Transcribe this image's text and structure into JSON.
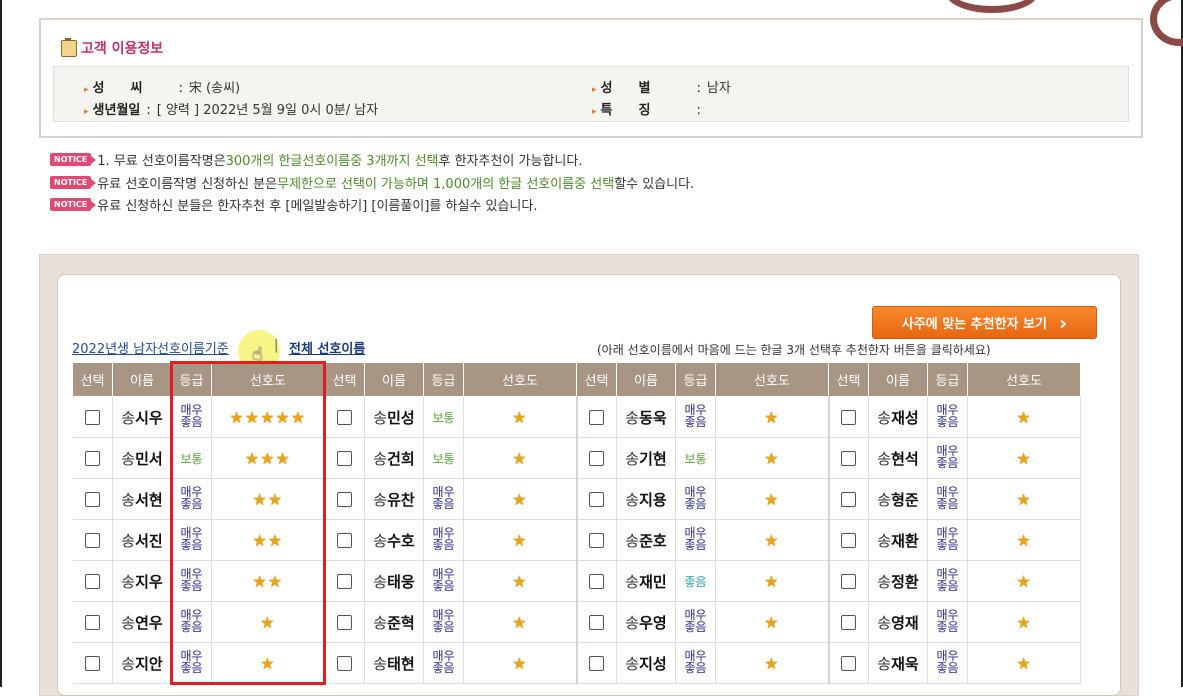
{
  "customer": {
    "title": "고객 이용정보",
    "surname_label": "성　　씨",
    "surname_value": "宋 (송씨)",
    "birth_label": "생년월일",
    "birth_value": "[ 양력 ] 2022년 5월 9일 0시 0분/ 남자",
    "gender_label": "성　　별",
    "gender_value": "남자",
    "trait_label": "특　　징",
    "trait_value": ""
  },
  "notices": {
    "tag": "NOTICE",
    "n1_a": "1. 무료 선호이름작명은 ",
    "n1_b": "300개의 한글선호이름중 3개까지 선택",
    "n1_c": "후 한자추천이 가능합니다.",
    "n2_a": "유료 선호이름작명 신청하신 분은",
    "n2_b": "무제한으로 선택이 가능하며 1,000개의 한글 선호이름중 선택",
    "n2_c": "할수 있습니다.",
    "n3": "유료 신청하신 분들은 한자추천 후 [메일발송하기] [이름풀이]를 하실수 있습니다."
  },
  "controls": {
    "recommend_button": "사주에 맞는 추천한자 보기",
    "recommend_arrow": "›",
    "link_year": "2022년생 남자선호이름기준",
    "link_sep": "|",
    "link_all": "전체 선호이름",
    "hint": "(아래 선호이름에서 마음에 드는 한글 3개 선택후 추천한자 버튼을 클릭하세요)"
  },
  "table_headers": {
    "select": "선택",
    "name": "이름",
    "grade": "등급",
    "pref": "선호도"
  },
  "grades": {
    "very_good_1": "매우",
    "very_good_2": "좋음",
    "ok": "보통",
    "good": "좋음"
  },
  "rows": [
    [
      {
        "s": "송",
        "g": "시우",
        "grade": "vg",
        "stars": "★★★★★"
      },
      {
        "s": "송",
        "g": "민성",
        "grade": "ok",
        "stars": "★"
      },
      {
        "s": "송",
        "g": "동욱",
        "grade": "vg",
        "stars": "★"
      },
      {
        "s": "송",
        "g": "재성",
        "grade": "vg",
        "stars": "★"
      }
    ],
    [
      {
        "s": "송",
        "g": "민서",
        "grade": "ok",
        "stars": "★★★"
      },
      {
        "s": "송",
        "g": "건희",
        "grade": "ok",
        "stars": "★"
      },
      {
        "s": "송",
        "g": "기현",
        "grade": "ok",
        "stars": "★"
      },
      {
        "s": "송",
        "g": "현석",
        "grade": "vg",
        "stars": "★"
      }
    ],
    [
      {
        "s": "송",
        "g": "서현",
        "grade": "vg",
        "stars": "★★"
      },
      {
        "s": "송",
        "g": "유찬",
        "grade": "vg",
        "stars": "★"
      },
      {
        "s": "송",
        "g": "지용",
        "grade": "vg",
        "stars": "★"
      },
      {
        "s": "송",
        "g": "형준",
        "grade": "vg",
        "stars": "★"
      }
    ],
    [
      {
        "s": "송",
        "g": "서진",
        "grade": "vg",
        "stars": "★★"
      },
      {
        "s": "송",
        "g": "수호",
        "grade": "vg",
        "stars": "★"
      },
      {
        "s": "송",
        "g": "준호",
        "grade": "vg",
        "stars": "★"
      },
      {
        "s": "송",
        "g": "재환",
        "grade": "vg",
        "stars": "★"
      }
    ],
    [
      {
        "s": "송",
        "g": "지우",
        "grade": "vg",
        "stars": "★★"
      },
      {
        "s": "송",
        "g": "태웅",
        "grade": "vg",
        "stars": "★"
      },
      {
        "s": "송",
        "g": "재민",
        "grade": "good",
        "stars": "★"
      },
      {
        "s": "송",
        "g": "정환",
        "grade": "vg",
        "stars": "★"
      }
    ],
    [
      {
        "s": "송",
        "g": "연우",
        "grade": "vg",
        "stars": "★"
      },
      {
        "s": "송",
        "g": "준혁",
        "grade": "vg",
        "stars": "★"
      },
      {
        "s": "송",
        "g": "우영",
        "grade": "vg",
        "stars": "★"
      },
      {
        "s": "송",
        "g": "영재",
        "grade": "vg",
        "stars": "★"
      }
    ],
    [
      {
        "s": "송",
        "g": "지안",
        "grade": "vg",
        "stars": "★"
      },
      {
        "s": "송",
        "g": "태현",
        "grade": "vg",
        "stars": "★"
      },
      {
        "s": "송",
        "g": "지성",
        "grade": "vg",
        "stars": "★"
      },
      {
        "s": "송",
        "g": "재욱",
        "grade": "vg",
        "stars": "★"
      }
    ]
  ],
  "colors": {
    "accent_orange": "#f07a20",
    "header_brown": "#a89584",
    "highlight_red": "#e02020",
    "title_pink": "#c0306a"
  }
}
